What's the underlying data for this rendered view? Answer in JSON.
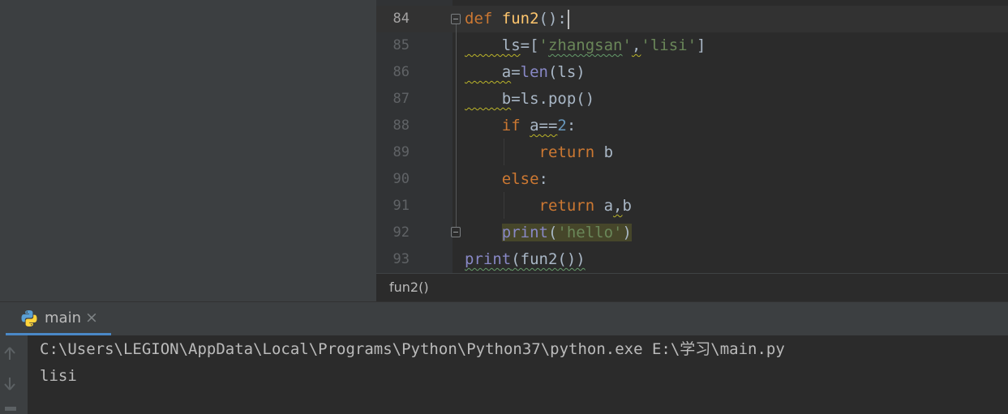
{
  "editor": {
    "lines": [
      {
        "num": "84",
        "tokens": [
          {
            "t": "def ",
            "c": "kw"
          },
          {
            "t": "fun2",
            "c": "fn"
          },
          {
            "t": "():",
            "c": ""
          }
        ]
      },
      {
        "num": "85",
        "tokens": [
          {
            "t": "    ls",
            "c": "warn"
          },
          {
            "t": "=[",
            "c": ""
          },
          {
            "t": "'",
            "c": "str"
          },
          {
            "t": "zhangsan",
            "c": "str typo"
          },
          {
            "t": "'",
            "c": "str"
          },
          {
            "t": ",",
            "c": "warn"
          },
          {
            "t": "'lisi'",
            "c": "str"
          },
          {
            "t": "]",
            "c": ""
          }
        ]
      },
      {
        "num": "86",
        "tokens": [
          {
            "t": "    a",
            "c": "warn"
          },
          {
            "t": "=",
            "c": ""
          },
          {
            "t": "len",
            "c": "bi"
          },
          {
            "t": "(ls)",
            "c": ""
          }
        ]
      },
      {
        "num": "87",
        "tokens": [
          {
            "t": "    b",
            "c": "warn"
          },
          {
            "t": "=ls.pop()",
            "c": ""
          }
        ]
      },
      {
        "num": "88",
        "tokens": [
          {
            "t": "    ",
            "c": ""
          },
          {
            "t": "if ",
            "c": "kw"
          },
          {
            "t": "a==",
            "c": "warn"
          },
          {
            "t": "2",
            "c": "num"
          },
          {
            "t": ":",
            "c": ""
          }
        ]
      },
      {
        "num": "89",
        "tokens": [
          {
            "t": "        ",
            "c": ""
          },
          {
            "t": "return ",
            "c": "kw"
          },
          {
            "t": "b",
            "c": ""
          }
        ]
      },
      {
        "num": "90",
        "tokens": [
          {
            "t": "    ",
            "c": ""
          },
          {
            "t": "else",
            "c": "kw"
          },
          {
            "t": ":",
            "c": ""
          }
        ]
      },
      {
        "num": "91",
        "tokens": [
          {
            "t": "        ",
            "c": ""
          },
          {
            "t": "return ",
            "c": "kw"
          },
          {
            "t": "a",
            "c": ""
          },
          {
            "t": ",",
            "c": "warn"
          },
          {
            "t": "b",
            "c": ""
          }
        ]
      },
      {
        "num": "92",
        "tokens": [
          {
            "t": "    ",
            "c": ""
          },
          {
            "t": "print",
            "c": "bi hl"
          },
          {
            "t": "(",
            "c": "hl"
          },
          {
            "t": "'hello'",
            "c": "str hl"
          },
          {
            "t": ")",
            "c": "hl"
          }
        ]
      },
      {
        "num": "93",
        "tokens": [
          {
            "t": "print",
            "c": "bi typo"
          },
          {
            "t": "(fun2())",
            "c": "typo"
          }
        ]
      }
    ]
  },
  "breadcrumb": {
    "text": "fun2()"
  },
  "run": {
    "tab_label": "main",
    "close_glyph": "×",
    "console_lines": [
      "C:\\Users\\LEGION\\AppData\\Local\\Programs\\Python\\Python37\\python.exe E:\\学习\\main.py",
      "lisi"
    ]
  },
  "icons": {
    "python": "python-icon",
    "rerun_up": "arrow-up-icon",
    "rerun_down": "arrow-down-icon"
  },
  "colors": {
    "keyword": "#cc7832",
    "function": "#ffc66d",
    "string": "#6a8759",
    "number": "#6897bb",
    "builtin": "#8888c6",
    "tab_underline": "#4a88c7"
  }
}
